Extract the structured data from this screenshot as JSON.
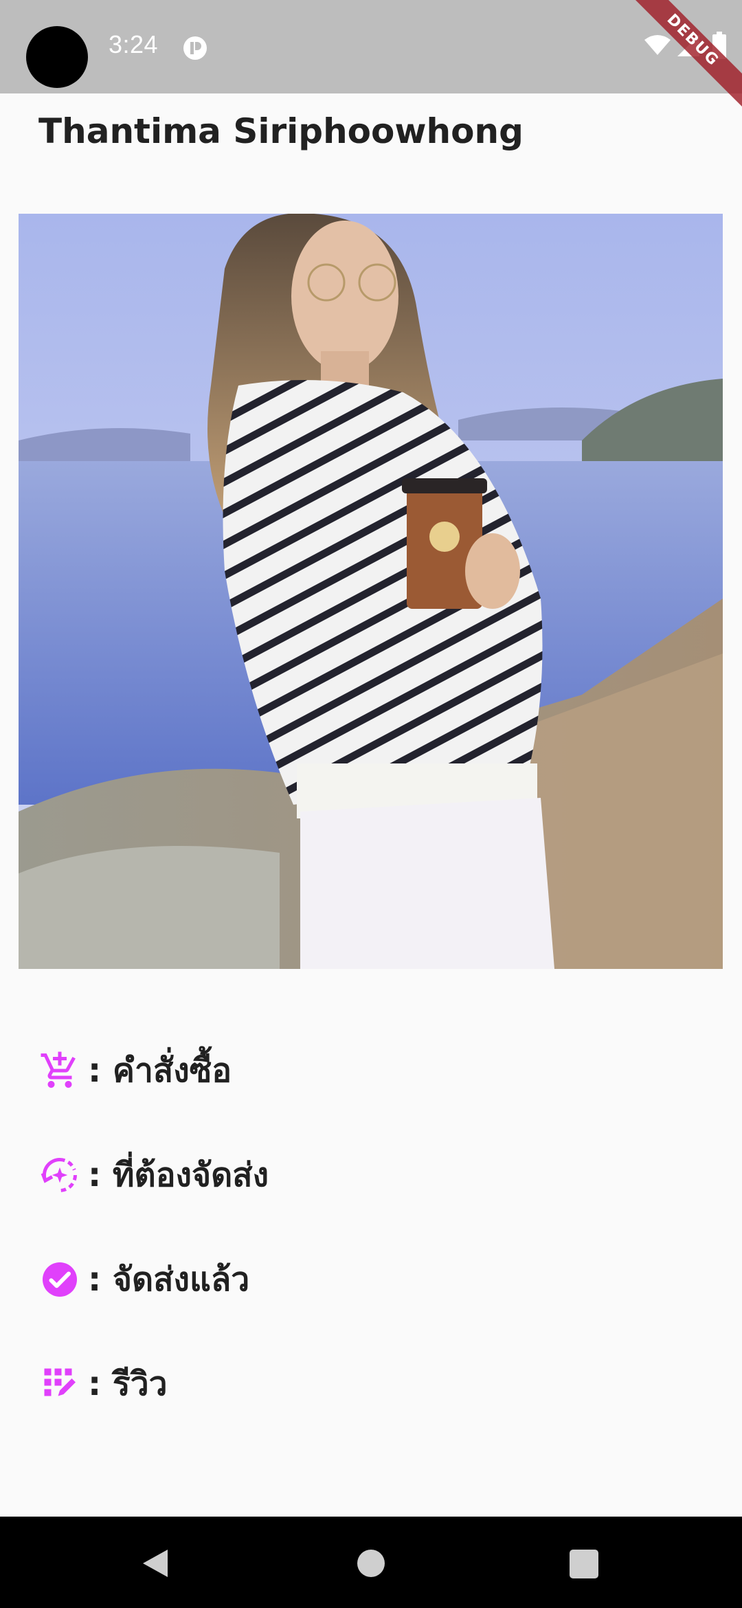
{
  "status_bar": {
    "time": "3:24"
  },
  "debug_banner": "DEBUG",
  "profile": {
    "name": "Thantima Siriphoowhong"
  },
  "menu": {
    "items": [
      {
        "icon": "cart-plus-icon",
        "label": ": คำสั่งซื้อ"
      },
      {
        "icon": "pending-sync-icon",
        "label": ": ที่ต้องจัดส่ง"
      },
      {
        "icon": "check-circle-icon",
        "label": ": จัดส่งแล้ว"
      },
      {
        "icon": "review-grid-icon",
        "label": ": รีวิว"
      }
    ]
  },
  "colors": {
    "accent": "#e040fb",
    "status_bar": "#bdbdbd",
    "background": "#fafafa",
    "nav_bar": "#000000",
    "debug_ribbon": "#a01e28"
  }
}
